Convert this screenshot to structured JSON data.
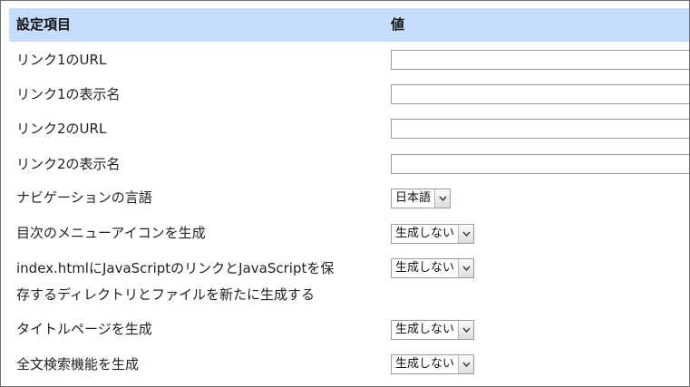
{
  "table": {
    "header": {
      "item": "設定項目",
      "value": "値"
    },
    "rows": [
      {
        "label": "リンク1のURL",
        "value": ""
      },
      {
        "label": "リンク1の表示名",
        "value": ""
      },
      {
        "label": "リンク2のURL",
        "value": ""
      },
      {
        "label": "リンク2の表示名",
        "value": ""
      },
      {
        "label": "ナビゲーションの言語",
        "selected": "日本語"
      },
      {
        "label": "目次のメニューアイコンを生成",
        "selected": "生成しない"
      },
      {
        "label_line1": "index.htmlにJavaScriptのリンクとJavaScriptを保",
        "label_line2": "存するディレクトリとファイルを新たに生成する",
        "selected": "生成しない"
      },
      {
        "label": "タイトルページを生成",
        "selected": "生成しない"
      },
      {
        "label": "全文検索機能を生成",
        "selected": "生成しない"
      }
    ]
  },
  "icons": {
    "dropdown": "chevron-down-icon"
  }
}
